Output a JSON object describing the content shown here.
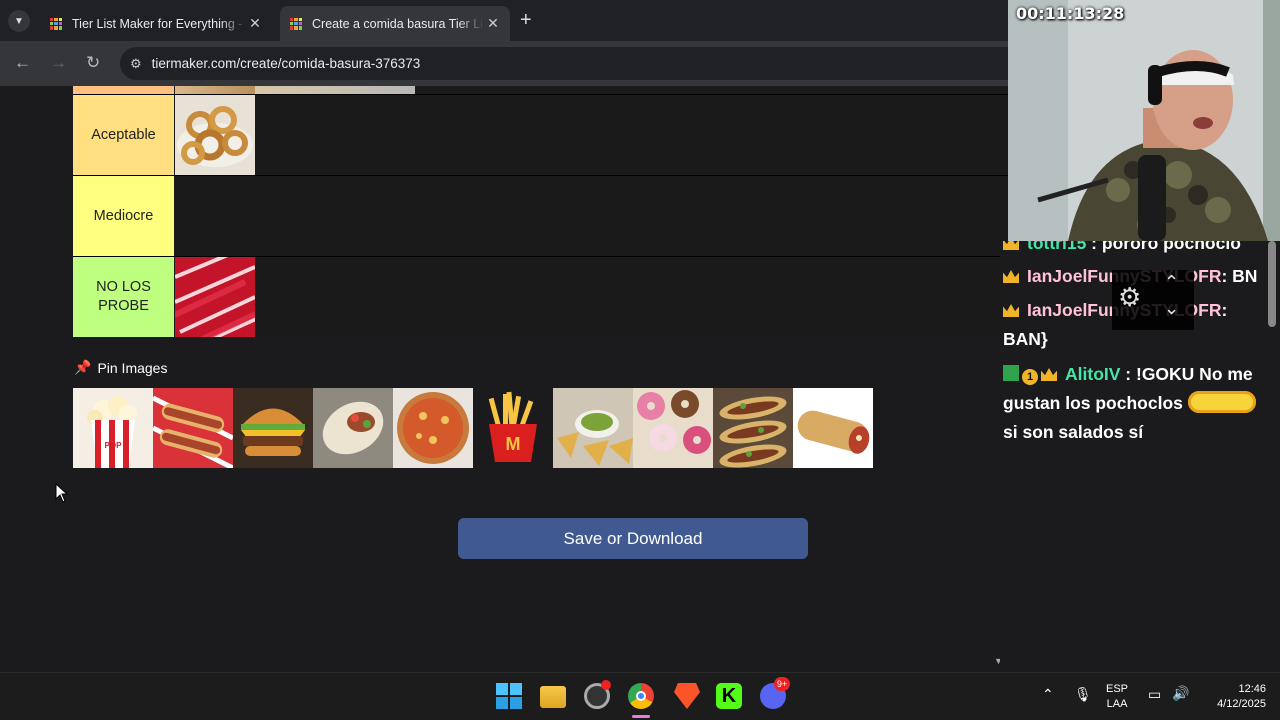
{
  "browser": {
    "tabs": [
      {
        "title": "Tier List Maker for Everything -",
        "active": false
      },
      {
        "title": "Create a comida basura Tier List",
        "active": true
      }
    ],
    "url": "tiermaker.com/create/comida-basura-376373"
  },
  "tiers": [
    {
      "label": "Aceptable",
      "color": "#ffdf80",
      "items": [
        "onion-rings"
      ]
    },
    {
      "label": "Mediocre",
      "color": "#ffff7f",
      "items": []
    },
    {
      "label": "NO LOS PROBE",
      "color": "#bfff7f",
      "items": [
        "red-candy-sticks"
      ]
    }
  ],
  "pin_images": {
    "label": "Pin Images",
    "items": [
      "popcorn",
      "hot-dogs",
      "burger",
      "wrap",
      "pizza",
      "fries",
      "nachos",
      "donuts",
      "tacos",
      "burrito"
    ]
  },
  "save_button": "Save or Download",
  "stream": {
    "timer": "00:11:13:28",
    "chat": [
      {
        "user": "tottri15",
        "text": "pororo pochoclo",
        "user_color": "#44e6a8"
      },
      {
        "user": "IanJoelFunnySTYLOFR",
        "text": ": BN",
        "user_color": "#ffc2d6"
      },
      {
        "user": "IanJoelFunnySTYLOFR",
        "text": ": BAN}",
        "user_color": "#ffc2d6"
      },
      {
        "user": "AlitoIV",
        "text": ": !GOKU No me gustan los pochoclos",
        "text2": "si son salados sí",
        "user_color": "#44e6a8"
      }
    ]
  },
  "taskbar": {
    "lang1": "ESP",
    "lang2": "LAA",
    "time": "12:46",
    "date": "4/12/2025",
    "discord_badge": "9+"
  }
}
